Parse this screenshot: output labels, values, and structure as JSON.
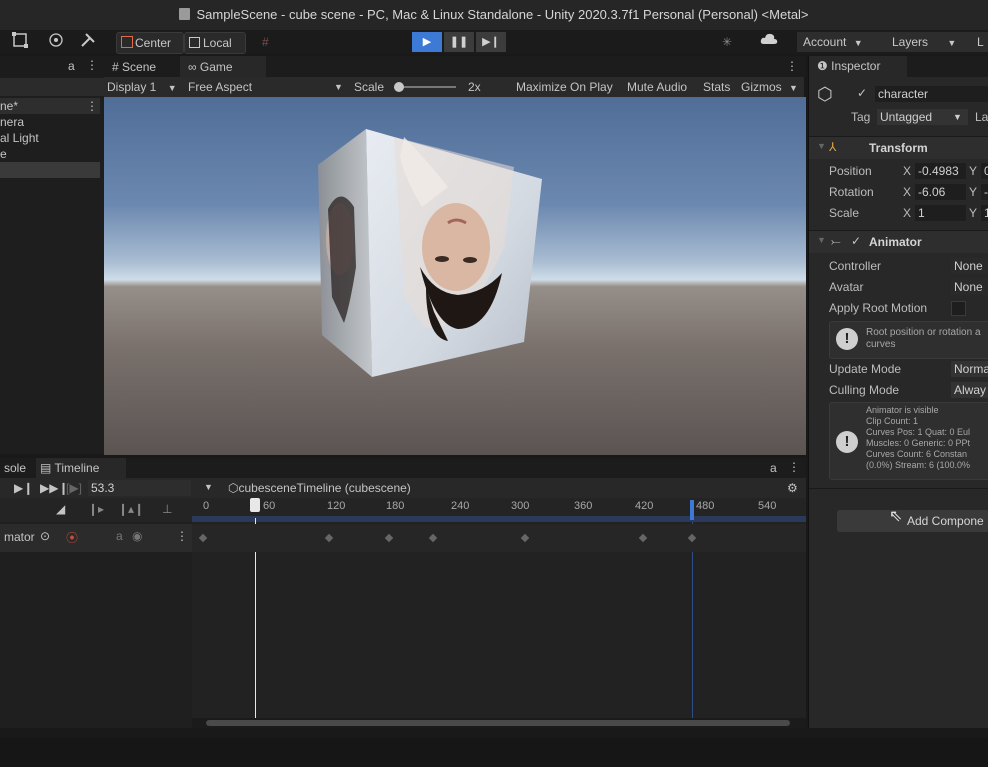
{
  "window": {
    "title": "SampleScene - cube scene - PC, Mac & Linux Standalone - Unity 2020.3.7f1 Personal (Personal) <Metal>"
  },
  "toolbar": {
    "center_label": "Center",
    "local_label": "Local",
    "account_label": "Account",
    "layers_label": "Layers",
    "layout_label": "L"
  },
  "hierarchy": {
    "items": [
      "ne*",
      "nera",
      "al Light",
      "e"
    ]
  },
  "tabs": {
    "scene": "Scene",
    "game": "Game",
    "inspector": "Inspector",
    "console": "sole",
    "timeline": "Timeline"
  },
  "game_bar": {
    "display": "Display 1",
    "aspect": "Free Aspect",
    "scale_label": "Scale",
    "scale_value": "2x",
    "maximize": "Maximize On Play",
    "mute": "Mute Audio",
    "stats": "Stats",
    "gizmos": "Gizmos"
  },
  "inspector": {
    "object_name": "character",
    "tag_label": "Tag",
    "tag_value": "Untagged",
    "layer_label": "La",
    "transform": {
      "title": "Transform",
      "position_label": "Position",
      "rotation_label": "Rotation",
      "scale_label": "Scale",
      "x": "X",
      "y": "Y",
      "pos_x": "-0.4983",
      "pos_y": "0",
      "rot_x": "-6.06",
      "rot_y": "-",
      "scale_x": "1",
      "scale_y": "1"
    },
    "animator": {
      "title": "Animator",
      "controller_label": "Controller",
      "controller_value": "None",
      "avatar_label": "Avatar",
      "avatar_value": "None",
      "root_motion_label": "Apply Root Motion",
      "help1_line1": "Root position or rotation a",
      "help1_line2": "curves",
      "update_label": "Update Mode",
      "update_value": "Norma",
      "culling_label": "Culling Mode",
      "culling_value": "Alway",
      "info_lines": [
        "Animator is visible",
        "Clip Count: 1",
        "Curves Pos: 1 Quat: 0 Eul",
        "Muscles: 0 Generic: 0 PPt",
        "Curves Count: 6 Constan",
        "(0.0%) Stream: 6 (100.0%"
      ]
    },
    "add_component": "Add Compone"
  },
  "timeline": {
    "frame": "53.3",
    "asset": "cubesceneTimeline (cubescene)",
    "track_name": "mator",
    "ticks": [
      "0",
      "60",
      "120",
      "180",
      "240",
      "300",
      "360",
      "420",
      "480",
      "540"
    ]
  },
  "colors": {
    "accent": "#3d7ad6",
    "panel": "#282828",
    "dark": "#1e1e1e"
  }
}
